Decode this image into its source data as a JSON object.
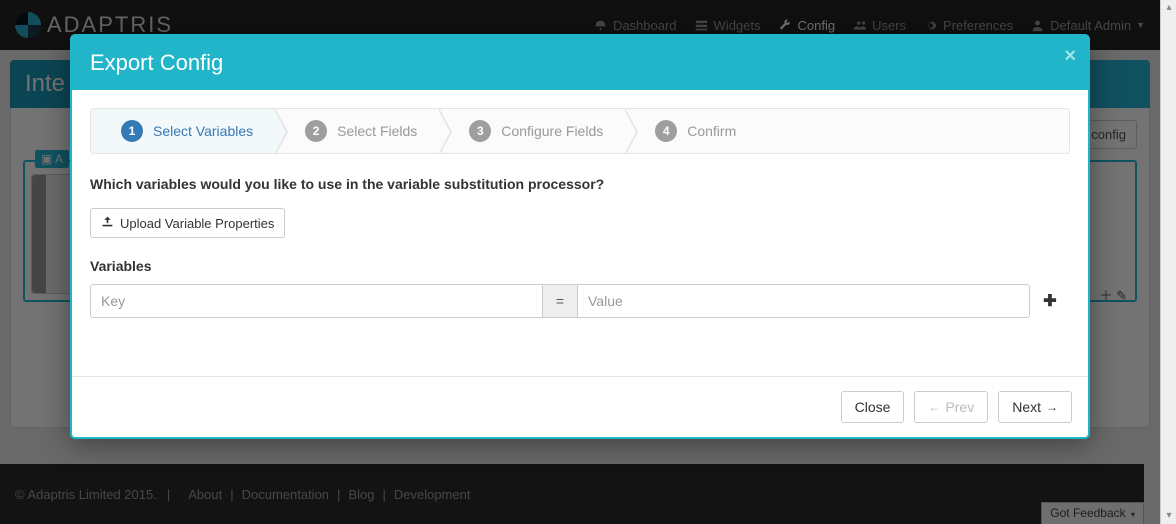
{
  "brand": "ADAPTRIS",
  "nav": {
    "dashboard": "Dashboard",
    "widgets": "Widgets",
    "config": "Config",
    "users": "Users",
    "preferences": "Preferences",
    "user_menu": "Default Admin"
  },
  "page": {
    "title_prefix": "Inte",
    "apply_config": "y config",
    "channel_label": "A"
  },
  "modal": {
    "title": "Export Config",
    "steps": {
      "s1": "Select Variables",
      "s2": "Select Fields",
      "s3": "Configure Fields",
      "s4": "Confirm",
      "n1": "1",
      "n2": "2",
      "n3": "3",
      "n4": "4"
    },
    "question": "Which variables would you like to use in the variable substitution processor?",
    "upload_label": "Upload Variable Properties",
    "variables_heading": "Variables",
    "equals": "=",
    "key_placeholder": "Key",
    "value_placeholder": "Value",
    "footer": {
      "close": "Close",
      "prev": "Prev",
      "next": "Next"
    }
  },
  "footer": {
    "copyright": "© Adaptris Limited 2015.",
    "about": "About",
    "documentation": "Documentation",
    "blog": "Blog",
    "development": "Development",
    "sep": "|"
  },
  "feedback": "Got Feedback"
}
